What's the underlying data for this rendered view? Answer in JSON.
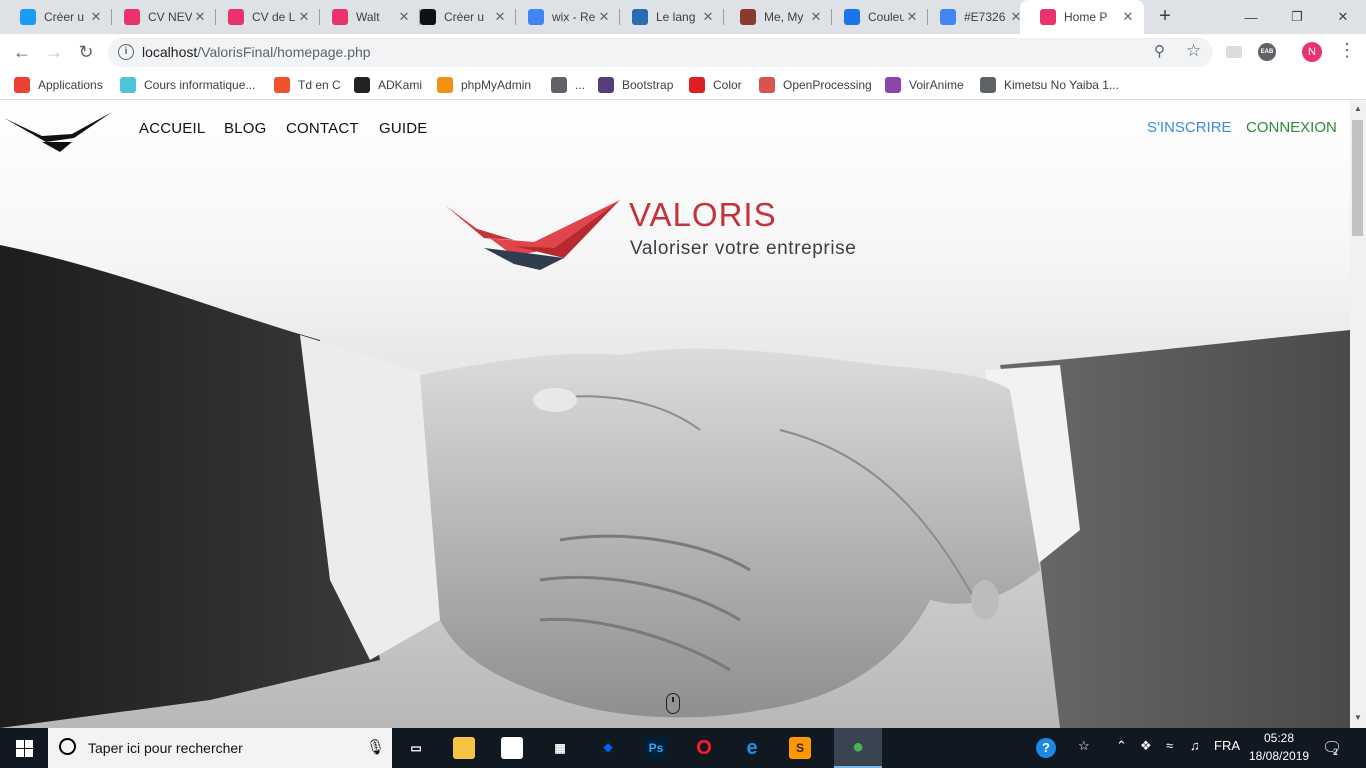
{
  "browser": {
    "tabs": [
      {
        "title": "Créer u",
        "favicon": "wix-icon",
        "color": "#1a9bf6"
      },
      {
        "title": "CV NEV",
        "favicon": "webflow-icon",
        "color": "#e8336d"
      },
      {
        "title": "CV de L",
        "favicon": "webflow-icon",
        "color": "#e8336d"
      },
      {
        "title": "Walt",
        "favicon": "walt-icon",
        "color": "#e8336d"
      },
      {
        "title": "Créer u",
        "favicon": "dji-icon",
        "color": "#111111"
      },
      {
        "title": "wix - Re",
        "favicon": "google-icon",
        "color": "#4285f4"
      },
      {
        "title": "Le lang",
        "favicon": "wordpress-icon",
        "color": "#2a6bb3"
      },
      {
        "title": "Me, My",
        "favicon": "avatar-icon",
        "color": "#8b3a2f"
      },
      {
        "title": "Couleu",
        "favicon": "hash-icon",
        "color": "#1a73e8"
      },
      {
        "title": "#E7326",
        "favicon": "google-icon",
        "color": "#4285f4"
      },
      {
        "title": "Home P",
        "favicon": "webflow-icon",
        "color": "#e8336d"
      }
    ],
    "active_tab": 10,
    "url_host": "localhost",
    "url_path": "/ValorisFinal/homepage.php",
    "profile_initial": "N",
    "extension_label": "EAB",
    "bookmarks": [
      {
        "label": "Applications",
        "icon": "apps-grid-icon",
        "color": "#ea4335"
      },
      {
        "label": "Cours informatique...",
        "icon": "cloud-icon",
        "color": "#4fc3d8"
      },
      {
        "label": "Td en C",
        "icon": "target-icon",
        "color": "#f0532b"
      },
      {
        "label": "ADKami",
        "icon": "adkami-icon",
        "color": "#222222"
      },
      {
        "label": "phpMyAdmin",
        "icon": "phpmyadmin-icon",
        "color": "#f29111"
      },
      {
        "label": "...",
        "icon": "globe-icon",
        "color": "#5f6368"
      },
      {
        "label": "Bootstrap",
        "icon": "bootstrap-icon",
        "color": "#563d7c"
      },
      {
        "label": "Color",
        "icon": "adobe-icon",
        "color": "#e02020"
      },
      {
        "label": "OpenProcessing",
        "icon": "openprocessing-icon",
        "color": "#d9534f"
      },
      {
        "label": "VoirAnime",
        "icon": "play-icon",
        "color": "#8e44ad"
      },
      {
        "label": "Kimetsu No Yaiba 1...",
        "icon": "globe-icon",
        "color": "#5f6368"
      }
    ]
  },
  "site": {
    "nav": [
      "ACCUEIL",
      "BLOG",
      "CONTACT",
      "GUIDE"
    ],
    "signup": "S'INSCRIRE",
    "login": "CONNEXION",
    "brand": "VALORIS",
    "tagline": "Valoriser votre entreprise",
    "colors": {
      "brand_red": "#c4323b",
      "signup_blue": "#3d8bd6",
      "login_green": "#2e8b3a"
    }
  },
  "taskbar": {
    "search_placeholder": "Taper ici pour rechercher",
    "apps": [
      "task-view-icon",
      "file-explorer-icon",
      "notepad-icon",
      "store-icon",
      "dropbox-icon",
      "photoshop-icon",
      "opera-icon",
      "edge-icon",
      "sublime-text-icon",
      "chrome-icon"
    ],
    "language": "FRA",
    "time": "05:28",
    "date": "18/08/2019",
    "notifications": "2"
  }
}
